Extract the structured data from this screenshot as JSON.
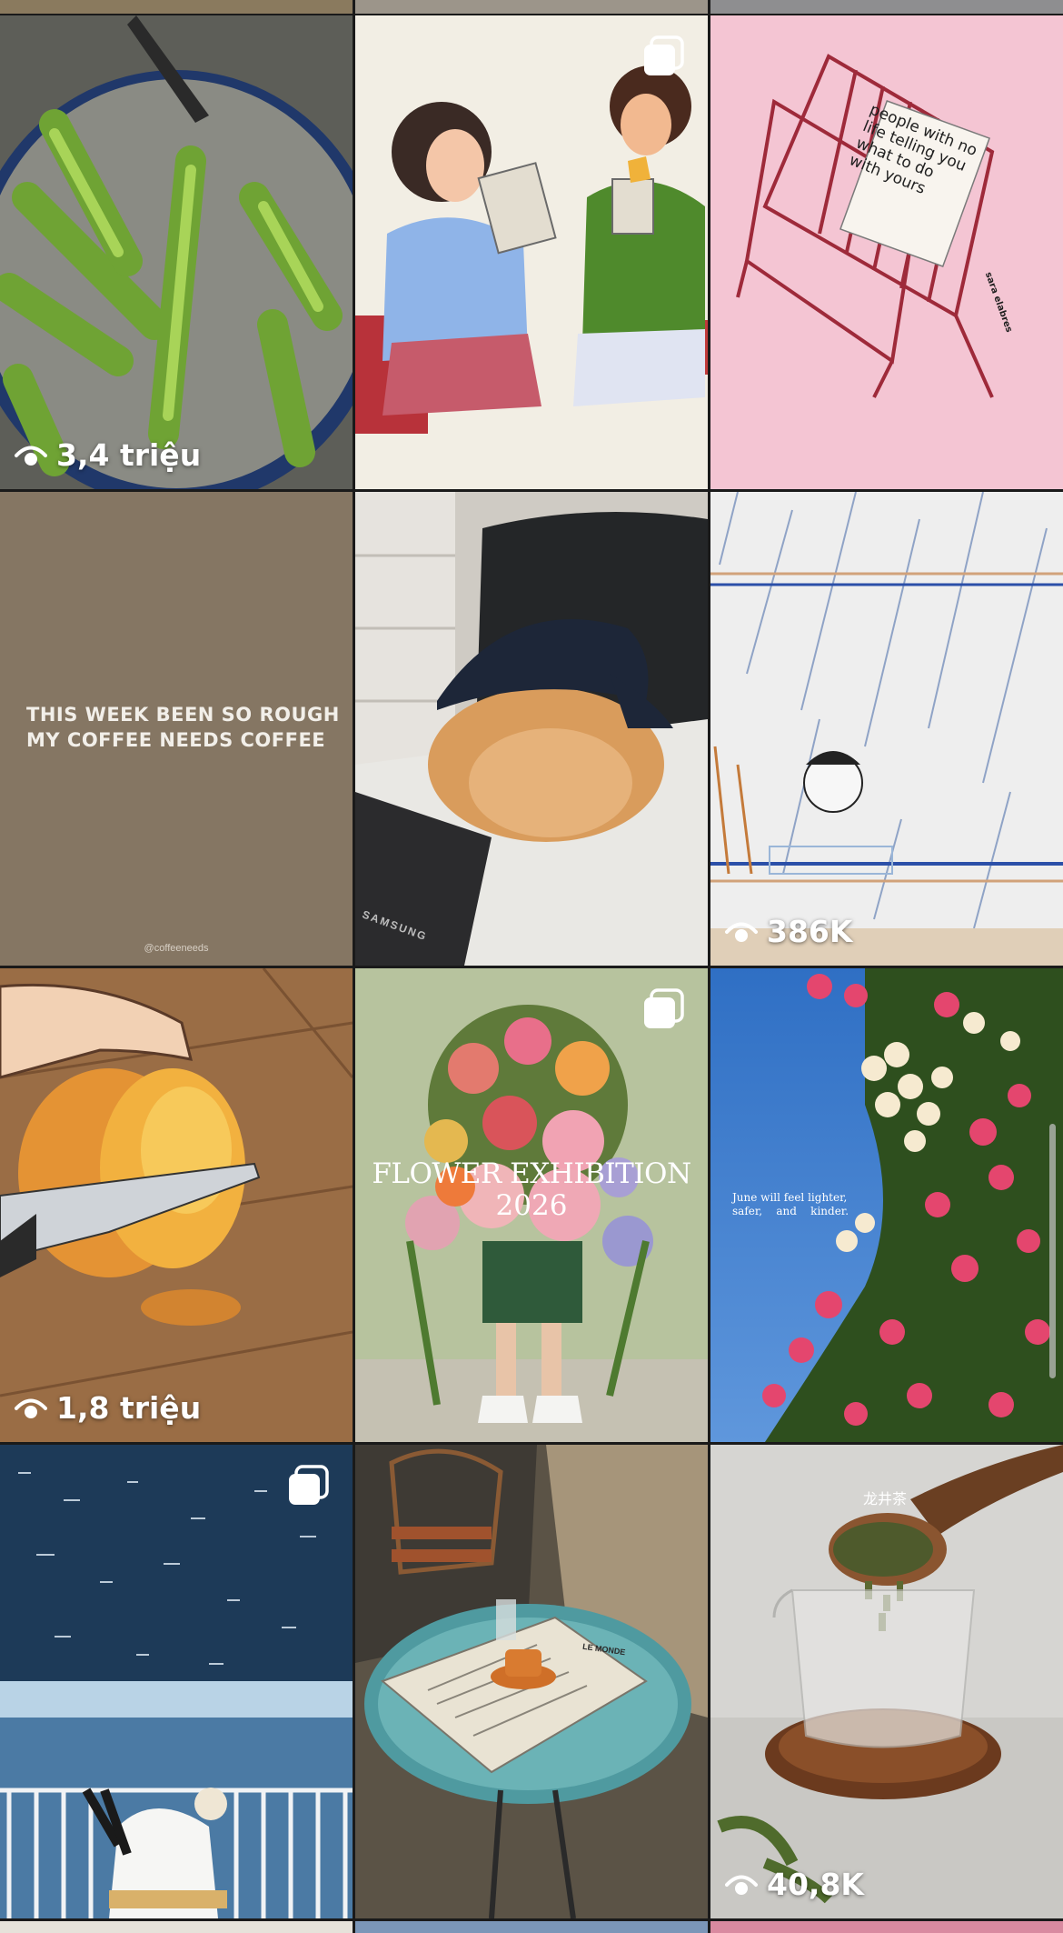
{
  "tiles": [
    {
      "name": "tile-green-vegetables",
      "views": "3,4 triệu"
    },
    {
      "name": "tile-newspaper-illustration",
      "carousel": true
    },
    {
      "name": "tile-wire-rack-illustration",
      "caption": "people with no life telling you what to do with yours",
      "signature": "sara elabres"
    },
    {
      "name": "tile-coffee-quote",
      "quote_line1": "THIS WEEK BEEN SO ROUGH",
      "quote_line2": "MY COFFEE NEEDS COFFEE",
      "handle": "@coffeeneeds"
    },
    {
      "name": "tile-cat-cap",
      "laptop_brand": "SAMSUNG"
    },
    {
      "name": "tile-rain-illustration",
      "views": "386K"
    },
    {
      "name": "tile-mango-anime",
      "views": "1,8 triệu"
    },
    {
      "name": "tile-flower-exhibition",
      "carousel": true,
      "title_line1": "FLOWER EXHIBITION",
      "title_line2": "2026"
    },
    {
      "name": "tile-june-flowers",
      "caption_line1": "June will feel lighter,",
      "caption_line2": "safer,    and    kinder."
    },
    {
      "name": "tile-ocean-balcony",
      "carousel": true
    },
    {
      "name": "tile-cafe-painting",
      "newspaper_title": "LE MONDE"
    },
    {
      "name": "tile-longjing-tea",
      "caption": "龙井茶",
      "views": "40,8K"
    }
  ],
  "icons": {
    "views": "eye-icon",
    "carousel": "carousel-icon"
  },
  "colors": {
    "grid_gap": "#1a1a1a",
    "overlay_text": "#ffffff",
    "scrollbar": "#bebebe"
  }
}
